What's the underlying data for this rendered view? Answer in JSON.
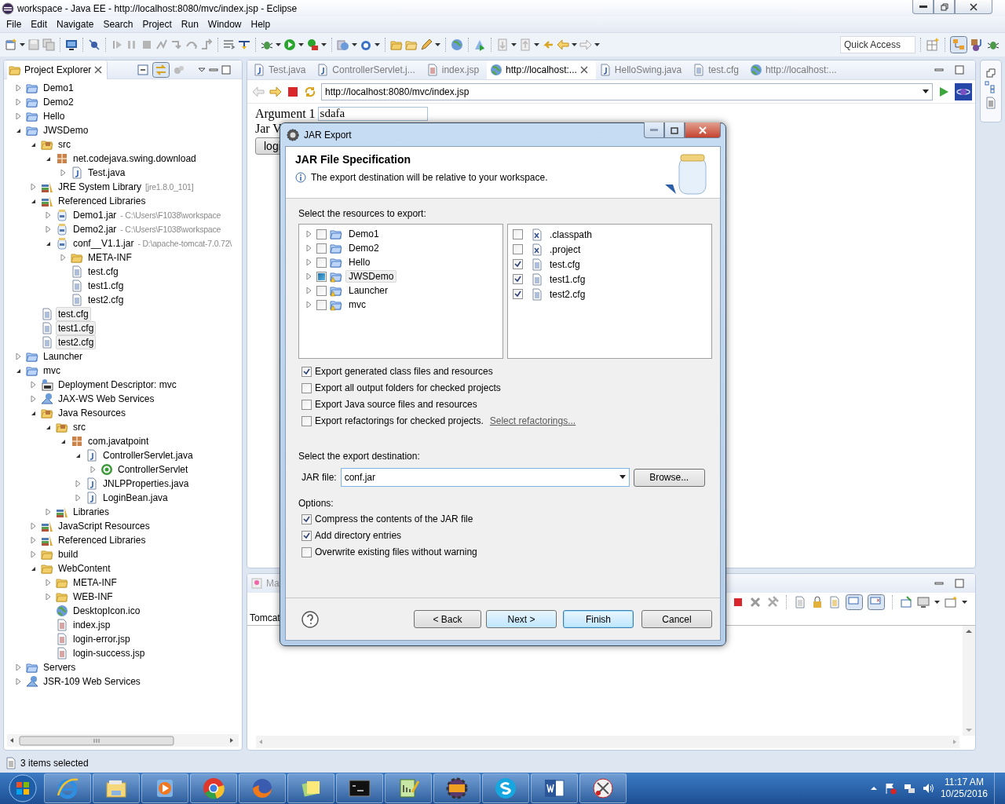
{
  "window": {
    "title": "workspace - Java EE - http://localhost:8080/mvc/index.jsp - Eclipse"
  },
  "menu": [
    "File",
    "Edit",
    "Navigate",
    "Search",
    "Project",
    "Run",
    "Window",
    "Help"
  ],
  "quick_access": {
    "placeholder": "Quick Access"
  },
  "project_explorer": {
    "title": "Project Explorer",
    "tree": [
      {
        "label": "Demo1",
        "kind": "project",
        "expanded": false,
        "selected": false
      },
      {
        "label": "Demo2",
        "kind": "project",
        "expanded": false,
        "selected": false
      },
      {
        "label": "Hello",
        "kind": "project",
        "expanded": false,
        "selected": false
      },
      {
        "label": "JWSDemo",
        "kind": "project",
        "expanded": true,
        "selected": false,
        "children": [
          {
            "label": "src",
            "kind": "source",
            "expanded": true,
            "selected": false,
            "children": [
              {
                "label": "net.codejava.swing.download",
                "kind": "package",
                "expanded": true,
                "selected": false,
                "children": [
                  {
                    "label": "Test.java",
                    "kind": "java",
                    "expanded": false,
                    "selected": false
                  }
                ]
              }
            ]
          },
          {
            "label": "JRE System Library",
            "detail": "[jre1.8.0_101]",
            "kind": "library",
            "expanded": false,
            "selected": false
          },
          {
            "label": "Referenced Libraries",
            "kind": "library",
            "expanded": true,
            "selected": false,
            "children": [
              {
                "label": "Demo1.jar",
                "detail": "- C:\\Users\\F1038\\workspace",
                "kind": "jar",
                "expanded": false,
                "selected": false
              },
              {
                "label": "Demo2.jar",
                "detail": "- C:\\Users\\F1038\\workspace",
                "kind": "jar",
                "expanded": false,
                "selected": false
              },
              {
                "label": "conf__V1.1.jar",
                "detail": "- D:\\apache-tomcat-7.0.72\\",
                "kind": "jar",
                "expanded": true,
                "selected": false,
                "children": [
                  {
                    "label": "META-INF",
                    "kind": "folder",
                    "expanded": false,
                    "selected": false
                  },
                  {
                    "label": "test.cfg",
                    "kind": "file",
                    "selected": false
                  },
                  {
                    "label": "test1.cfg",
                    "kind": "file",
                    "selected": false
                  },
                  {
                    "label": "test2.cfg",
                    "kind": "file",
                    "selected": false
                  }
                ]
              }
            ]
          },
          {
            "label": "test.cfg",
            "kind": "file",
            "selected": true
          },
          {
            "label": "test1.cfg",
            "kind": "file",
            "selected": true
          },
          {
            "label": "test2.cfg",
            "kind": "file",
            "selected": true
          }
        ]
      },
      {
        "label": "Launcher",
        "kind": "project",
        "expanded": false,
        "selected": false
      },
      {
        "label": "mvc",
        "kind": "project",
        "expanded": true,
        "selected": false,
        "children": [
          {
            "label": "Deployment Descriptor: mvc",
            "kind": "descriptor",
            "expanded": false,
            "selected": false
          },
          {
            "label": "JAX-WS Web Services",
            "kind": "services",
            "expanded": false,
            "selected": false
          },
          {
            "label": "Java Resources",
            "kind": "source",
            "expanded": true,
            "selected": false,
            "children": [
              {
                "label": "src",
                "kind": "source",
                "expanded": true,
                "selected": false,
                "children": [
                  {
                    "label": "com.javatpoint",
                    "kind": "package",
                    "expanded": true,
                    "selected": false,
                    "children": [
                      {
                        "label": "ControllerServlet.java",
                        "kind": "java",
                        "expanded": true,
                        "selected": false,
                        "children": [
                          {
                            "label": "ControllerServlet",
                            "kind": "class",
                            "expanded": false,
                            "selected": false
                          }
                        ]
                      },
                      {
                        "label": "JNLPProperties.java",
                        "kind": "java",
                        "expanded": false,
                        "selected": false
                      },
                      {
                        "label": "LoginBean.java",
                        "kind": "java",
                        "expanded": false,
                        "selected": false
                      }
                    ]
                  }
                ]
              },
              {
                "label": "Libraries",
                "kind": "library",
                "expanded": false,
                "selected": false
              }
            ]
          },
          {
            "label": "JavaScript Resources",
            "kind": "library",
            "expanded": false,
            "selected": false
          },
          {
            "label": "Referenced Libraries",
            "kind": "library",
            "expanded": false,
            "selected": false
          },
          {
            "label": "build",
            "kind": "folder",
            "expanded": false,
            "selected": false
          },
          {
            "label": "WebContent",
            "kind": "folder",
            "expanded": true,
            "selected": false,
            "children": [
              {
                "label": "META-INF",
                "kind": "folder",
                "expanded": false,
                "selected": false
              },
              {
                "label": "WEB-INF",
                "kind": "folder",
                "expanded": false,
                "selected": false
              },
              {
                "label": "DesktopIcon.ico",
                "kind": "globe",
                "selected": false
              },
              {
                "label": "index.jsp",
                "kind": "jsp",
                "selected": false
              },
              {
                "label": "login-error.jsp",
                "kind": "jsp",
                "selected": false
              },
              {
                "label": "login-success.jsp",
                "kind": "jsp",
                "selected": false
              }
            ]
          }
        ]
      },
      {
        "label": "Servers",
        "kind": "bluefolder",
        "expanded": false,
        "selected": false
      },
      {
        "label": "JSR-109 Web Services",
        "kind": "services",
        "expanded": false,
        "selected": false
      }
    ]
  },
  "editor": {
    "tabs": [
      {
        "label": "Test.java",
        "kind": "java",
        "selected": false
      },
      {
        "label": "ControllerServlet.j...",
        "kind": "java",
        "selected": false
      },
      {
        "label": "index.jsp",
        "kind": "jsp",
        "selected": false
      },
      {
        "label": "http://localhost:...",
        "kind": "globe",
        "selected": true
      },
      {
        "label": "HelloSwing.java",
        "kind": "java",
        "selected": false
      },
      {
        "label": "test.cfg",
        "kind": "file",
        "selected": false
      },
      {
        "label": "http://localhost:...",
        "kind": "globe",
        "selected": false
      }
    ],
    "url": "http://localhost:8080/mvc/index.jsp",
    "page": {
      "argument_label": "Argument 1",
      "argument_value": "sdafa",
      "jar_label": "Jar V",
      "login_button": "logi"
    }
  },
  "bottom_panel": {
    "tab": "Ma",
    "server": "Tomcat"
  },
  "status_bar": {
    "text": "3 items selected"
  },
  "dialog": {
    "title": "JAR Export",
    "heading": "JAR File Specification",
    "message": "The export destination will be relative to your workspace.",
    "resources_label": "Select the resources to export:",
    "projects": [
      {
        "label": "Demo1",
        "checked": false,
        "partial": false,
        "selected": false,
        "warning": false
      },
      {
        "label": "Demo2",
        "checked": false,
        "partial": false,
        "selected": false,
        "warning": false
      },
      {
        "label": "Hello",
        "checked": false,
        "partial": false,
        "selected": false,
        "warning": false
      },
      {
        "label": "JWSDemo",
        "checked": false,
        "partial": true,
        "selected": true,
        "warning": true
      },
      {
        "label": "Launcher",
        "checked": false,
        "partial": false,
        "selected": false,
        "warning": true
      },
      {
        "label": "mvc",
        "checked": false,
        "partial": false,
        "selected": false,
        "warning": true
      }
    ],
    "files": [
      {
        "label": ".classpath",
        "kind": "xml",
        "checked": false
      },
      {
        "label": ".project",
        "kind": "xml",
        "checked": false
      },
      {
        "label": "test.cfg",
        "kind": "file",
        "checked": true
      },
      {
        "label": "test1.cfg",
        "kind": "file",
        "checked": true
      },
      {
        "label": "test2.cfg",
        "kind": "file",
        "checked": true
      }
    ],
    "export_options": [
      {
        "label": "Export generated class files and resources",
        "checked": true
      },
      {
        "label": "Export all output folders for checked projects",
        "checked": false
      },
      {
        "label": "Export Java source files and resources",
        "checked": false
      },
      {
        "label": "Export refactorings for checked projects.",
        "checked": false,
        "link": "Select refactorings..."
      }
    ],
    "destination_label": "Select the export destination:",
    "jar_file": {
      "label": "JAR file:",
      "value": "conf.jar",
      "browse": "Browse..."
    },
    "options_label": "Options:",
    "options": [
      {
        "label": "Compress the contents of the JAR file",
        "checked": true
      },
      {
        "label": "Add directory entries",
        "checked": true
      },
      {
        "label": "Overwrite existing files without warning",
        "checked": false
      }
    ],
    "buttons": [
      {
        "label": "< Back",
        "kind": "normal"
      },
      {
        "label": "Next >",
        "kind": "hover"
      },
      {
        "label": "Finish",
        "kind": "default"
      },
      {
        "label": "Cancel",
        "kind": "normal"
      }
    ]
  },
  "taskbar": {
    "apps": [
      {
        "kind": "ie"
      },
      {
        "kind": "explorer"
      },
      {
        "kind": "media"
      },
      {
        "kind": "chrome"
      },
      {
        "kind": "firefox"
      },
      {
        "kind": "notes"
      },
      {
        "kind": "console"
      },
      {
        "kind": "notepad"
      },
      {
        "kind": "eclipse"
      },
      {
        "kind": "skype"
      },
      {
        "kind": "word"
      },
      {
        "kind": "snip"
      }
    ],
    "clock": {
      "time": "11:17 AM",
      "date": "10/25/2016"
    }
  }
}
